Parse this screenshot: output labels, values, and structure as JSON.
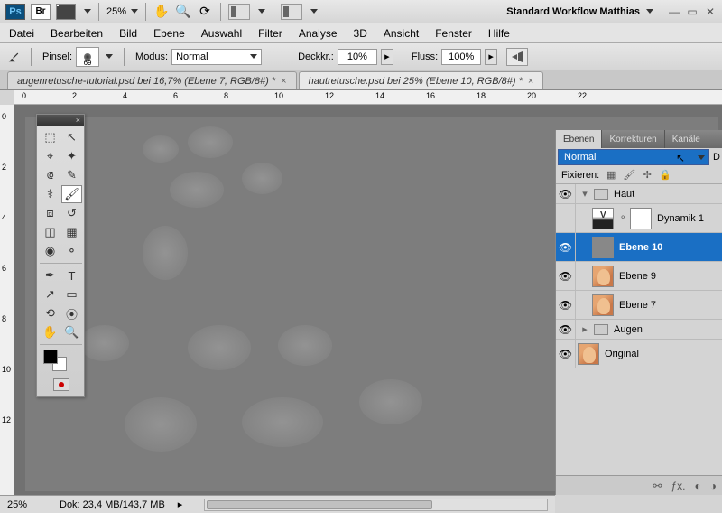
{
  "topbar": {
    "ps_label": "Ps",
    "br_label": "Br",
    "zoom": "25%",
    "workspace": "Standard Workflow Matthias"
  },
  "menu": [
    "Datei",
    "Bearbeiten",
    "Bild",
    "Ebene",
    "Auswahl",
    "Filter",
    "Analyse",
    "3D",
    "Ansicht",
    "Fenster",
    "Hilfe"
  ],
  "options": {
    "pinsel_label": "Pinsel:",
    "pinsel_size": "69",
    "modus_label": "Modus:",
    "modus_value": "Normal",
    "deckkr_label": "Deckkr.:",
    "deckkr_value": "10%",
    "fluss_label": "Fluss:",
    "fluss_value": "100%"
  },
  "tabs": [
    {
      "label": "augenretusche-tutorial.psd bei 16,7% (Ebene 7, RGB/8#) *",
      "active": false
    },
    {
      "label": "hautretusche.psd bei 25% (Ebene 10, RGB/8#) *",
      "active": true
    }
  ],
  "ruler_h": [
    "0",
    "2",
    "4",
    "6",
    "8",
    "10",
    "12",
    "14",
    "16",
    "18",
    "20",
    "22"
  ],
  "ruler_v": [
    "0",
    "2",
    "4",
    "6",
    "8",
    "10",
    "12"
  ],
  "panels": {
    "tabs": [
      "Ebenen",
      "Korrekturen",
      "Kanäle"
    ],
    "active_tab": 0,
    "blend_mode": "Normal",
    "d_suffix": "D",
    "fixieren": "Fixieren:"
  },
  "layers": [
    {
      "type": "group",
      "name": "Haut",
      "vis": true,
      "expanded": true
    },
    {
      "type": "adjust",
      "name": "Dynamik 1",
      "vis": false,
      "indent": 1,
      "thumb": "dyn",
      "mask": true
    },
    {
      "type": "layer",
      "name": "Ebene 10",
      "vis": true,
      "indent": 1,
      "thumb": "gray",
      "selected": true
    },
    {
      "type": "layer",
      "name": "Ebene 9",
      "vis": true,
      "indent": 1,
      "thumb": "face"
    },
    {
      "type": "layer",
      "name": "Ebene 7",
      "vis": true,
      "indent": 1,
      "thumb": "face"
    },
    {
      "type": "group",
      "name": "Augen",
      "vis": true,
      "expanded": false
    },
    {
      "type": "layer",
      "name": "Original",
      "vis": true,
      "indent": 0,
      "thumb": "face"
    }
  ],
  "status": {
    "zoom": "25%",
    "dok": "Dok: 23,4 MB/143,7 MB"
  }
}
